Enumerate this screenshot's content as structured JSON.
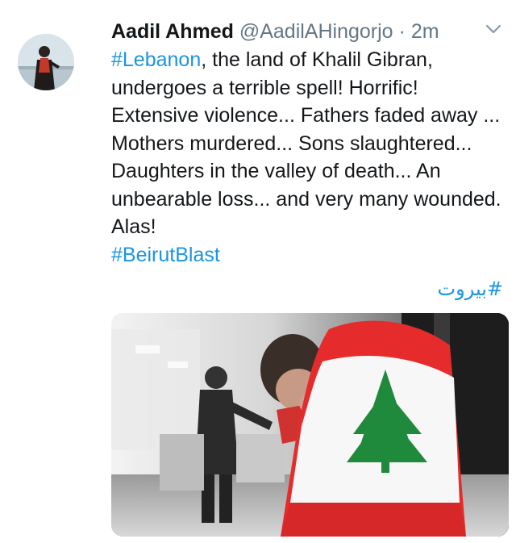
{
  "tweet": {
    "author_name": "Aadil Ahmed",
    "handle": "@AadilAHingorjo",
    "separator": "·",
    "time": "2m",
    "hashtag_lebanon": "#Lebanon",
    "body_rest": ", the land of Khalil Gibran, undergoes a terrible spell! Horrific! Extensive violence... Fathers faded away ... Mothers murdered... Sons slaughtered... Daughters in the valley of death... An unbearable loss... and very many wounded. Alas!",
    "hashtag_beirut_blast": "#BeirutBlast",
    "hashtag_arabic": "#بيروت"
  },
  "colors": {
    "link": "#1b95e0",
    "muted": "#657786",
    "flag_red": "#e52b2b",
    "flag_green": "#1f8a3b"
  },
  "icons": {
    "menu": "chevron-down-icon"
  }
}
